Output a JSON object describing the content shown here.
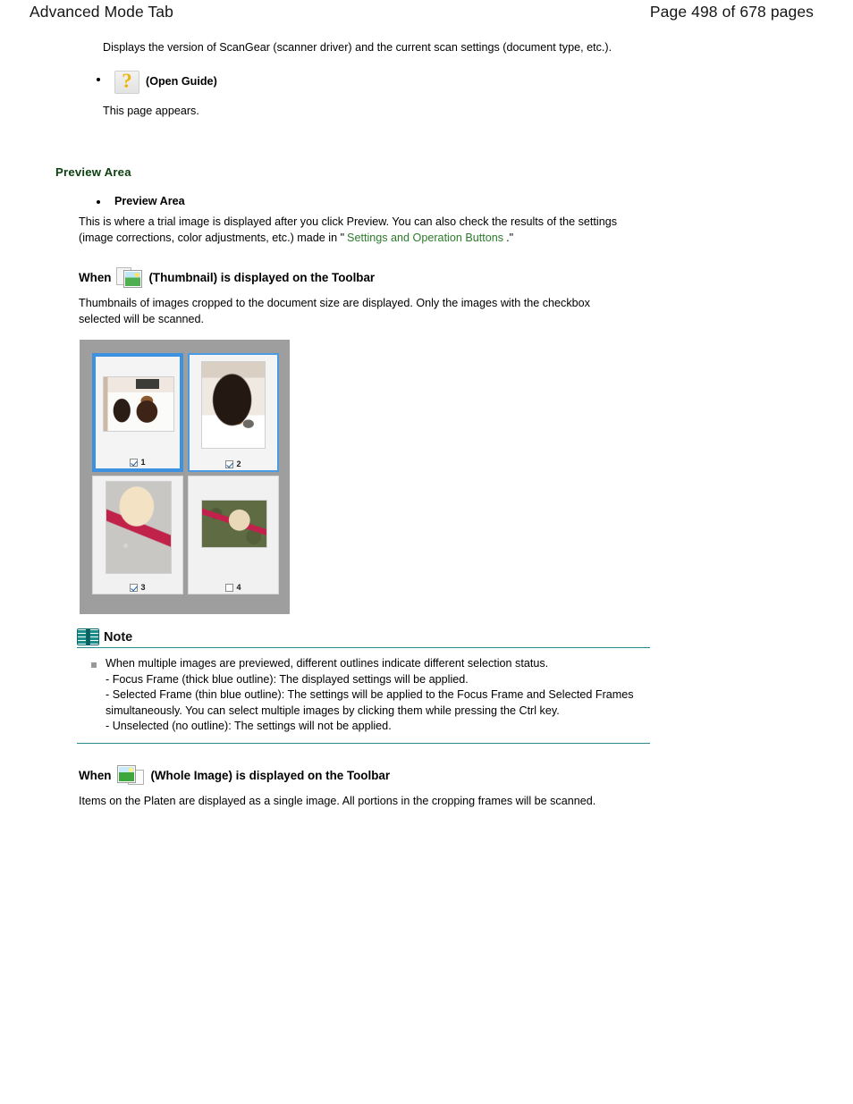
{
  "header": {
    "title": "Advanced Mode Tab",
    "page_label": "Page 498 of 678 pages"
  },
  "intro": {
    "paragraph": "Displays the version of ScanGear (scanner driver) and the current scan settings (document type, etc.).",
    "open_guide_label": "(Open Guide)",
    "open_guide_icon": "question-mark-icon",
    "open_guide_followup": "This page appears."
  },
  "preview_section": {
    "heading": "Preview Area",
    "bullet_label": "Preview Area",
    "body_part1": "This is where a trial image is displayed after you click Preview. You can also check the results of the settings (image corrections, color adjustments, etc.) made in \"",
    "link_text": "Settings and Operation Buttons",
    "body_part2": ".\""
  },
  "thumbnail_section": {
    "heading_before": "When",
    "heading_after": "(Thumbnail) is displayed on the Toolbar",
    "icon": "thumbnail-view-icon",
    "body": "Thumbnails of images cropped to the document size are displayed. Only the images with the checkbox selected will be scanned."
  },
  "preview_panel": {
    "frames": [
      {
        "number": "1",
        "checked": true,
        "outline": "focus",
        "alt": "two dachshunds on white floor"
      },
      {
        "number": "2",
        "checked": true,
        "outline": "selected",
        "alt": "close-up of black and tan dachshund"
      },
      {
        "number": "3",
        "checked": true,
        "outline": "unselected",
        "alt": "yellow labrador with red leash on gravel"
      },
      {
        "number": "4",
        "checked": false,
        "outline": "unselected",
        "alt": "yellow labrador with red leash on grass"
      }
    ]
  },
  "note": {
    "title": "Note",
    "icon": "open-book-icon",
    "lines": [
      "When multiple images are previewed, different outlines indicate different selection status.",
      "- Focus Frame (thick blue outline): The displayed settings will be applied.",
      "- Selected Frame (thin blue outline): The settings will be applied to the Focus Frame and Selected Frames simultaneously. You can select multiple images by clicking them while pressing the Ctrl key.",
      "- Unselected (no outline): The settings will not be applied."
    ]
  },
  "whole_image_section": {
    "heading_before": "When",
    "heading_after": "(Whole Image) is displayed on the Toolbar",
    "icon": "whole-image-view-icon",
    "body": "Items on the Platen are displayed as a single image. All portions in the cropping frames will be scanned."
  },
  "colors": {
    "section_heading": "#0d4010",
    "link": "#2a7a2a",
    "note_rule": "#2b8b8b",
    "focus_outline": "#3c92e0",
    "selected_outline": "#4b9ae4",
    "panel_background": "#9e9e9e"
  }
}
